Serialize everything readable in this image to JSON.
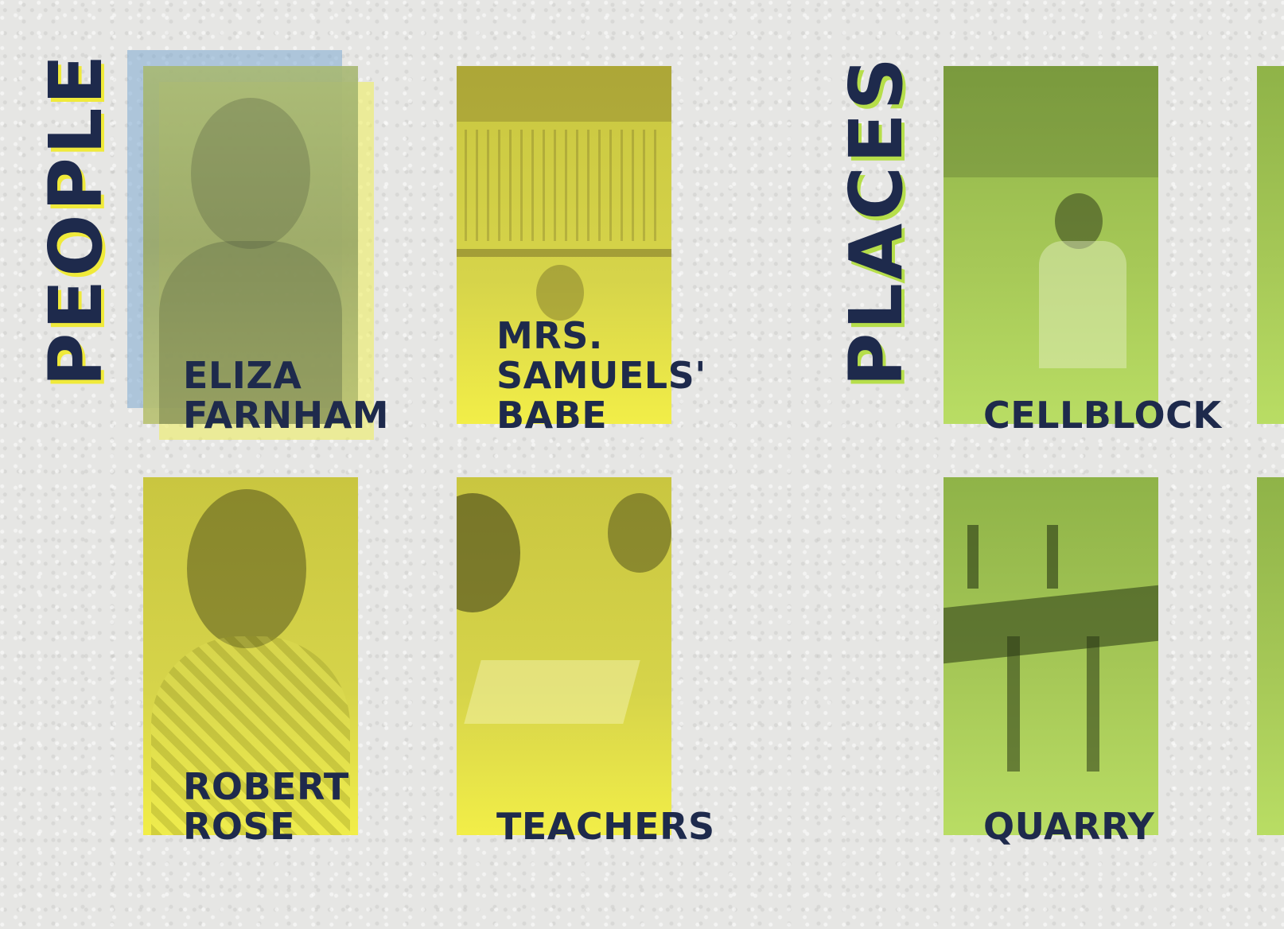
{
  "sections": {
    "people": {
      "title": "PEOPLE"
    },
    "places": {
      "title": "PLACES"
    }
  },
  "people": [
    {
      "id": "eliza",
      "label": "ELIZA\nFARNHAM"
    },
    {
      "id": "samuels",
      "label": "MRS.\nSAMUELS'\nBABE"
    },
    {
      "id": "robert",
      "label": "ROBERT\nROSE"
    },
    {
      "id": "teachers",
      "label": "TEACHERS"
    }
  ],
  "places": [
    {
      "id": "cellblock",
      "label": "CELLBLOCK"
    },
    {
      "id": "quarry",
      "label": "QUARRY"
    }
  ],
  "colors": {
    "navy": "#1e2a4c",
    "yellow": "#f0ea3a",
    "green": "#b6de4a",
    "background": "#e6e6e4"
  }
}
